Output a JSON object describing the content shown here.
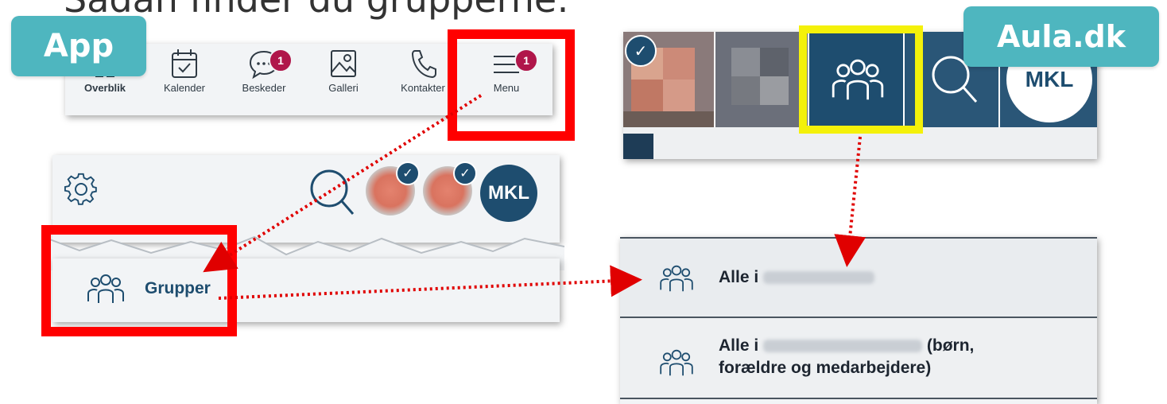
{
  "title_fragment": "Sådan finder du grupperne:",
  "tags": {
    "app": "App",
    "web": "Aula.dk"
  },
  "app_nav": {
    "items": [
      {
        "label": "Overblik"
      },
      {
        "label": "Kalender"
      },
      {
        "label": "Beskeder",
        "badge": "1"
      },
      {
        "label": "Galleri"
      },
      {
        "label": "Kontakter"
      },
      {
        "label": "Menu",
        "badge": "1"
      }
    ]
  },
  "app_menu": {
    "avatar_initials": "MKL",
    "groups_label": "Grupper"
  },
  "web": {
    "avatar_initials": "MKL",
    "rows": [
      {
        "prefix": "Alle i",
        "suffix": ""
      },
      {
        "prefix": "Alle i",
        "suffix": "(børn,",
        "line2": "forældre og medarbejdere)"
      }
    ]
  },
  "colors": {
    "accent_red": "#ff0000",
    "highlight_yellow": "#f4f10a",
    "aula_blue": "#1e4d6f",
    "badge": "#b0164a",
    "tag_teal": "#4eb6bf"
  }
}
